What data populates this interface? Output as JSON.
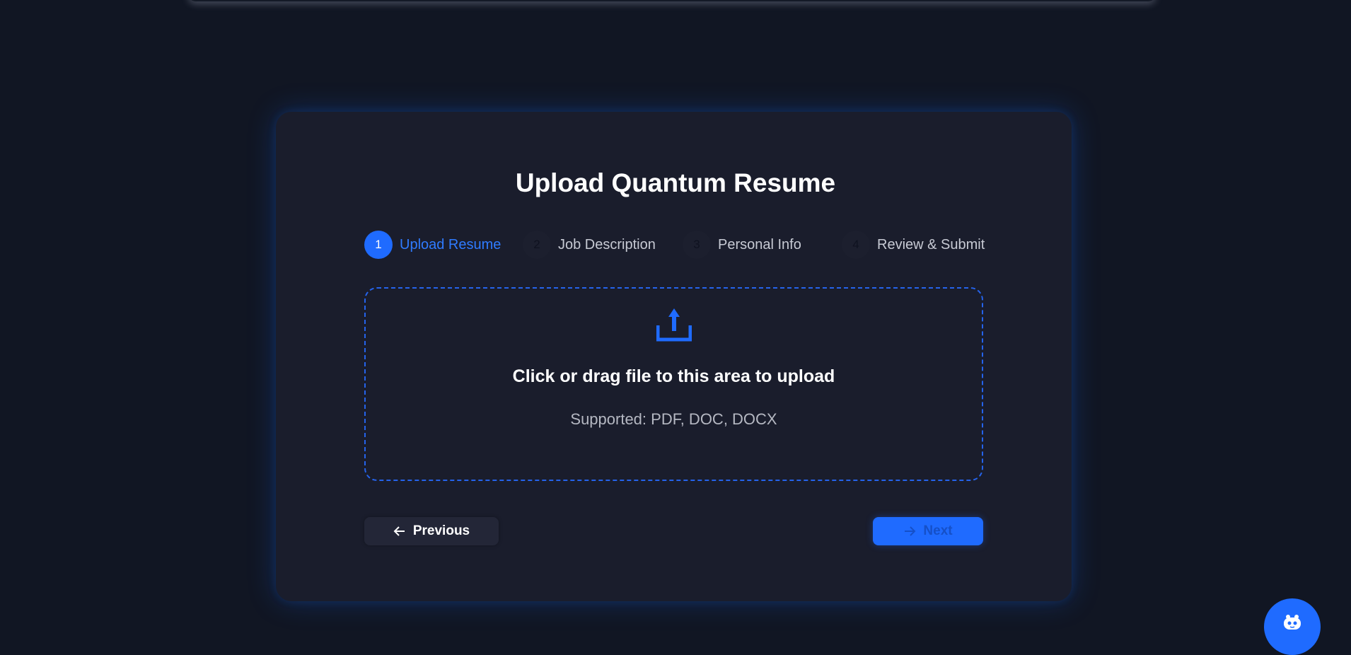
{
  "page": {
    "title": "Upload Quantum Resume"
  },
  "steps": [
    {
      "number": "1",
      "label": "Upload Resume",
      "active": true
    },
    {
      "number": "2",
      "label": "Job Description",
      "active": false
    },
    {
      "number": "3",
      "label": "Personal Info",
      "active": false
    },
    {
      "number": "4",
      "label": "Review & Submit",
      "active": false
    }
  ],
  "dropzone": {
    "icon": "upload-icon",
    "title": "Click or drag file to this area to upload",
    "hint": "Supported: PDF, DOC, DOCX"
  },
  "navigation": {
    "previous_label": "Previous",
    "previous_icon": "arrow-left-icon",
    "next_label": "Next",
    "next_icon": "arrow-right-icon"
  },
  "assistant_button": {
    "icon": "robot-icon"
  },
  "colors": {
    "background": "#111623",
    "card": "#1a1d2c",
    "accent": "#1f6bff",
    "text": "#ffffff",
    "muted_text": "#c7cad4"
  }
}
